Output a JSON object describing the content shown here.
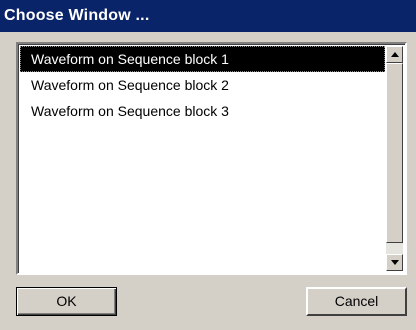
{
  "window": {
    "title": "Choose Window ..."
  },
  "list": {
    "items": [
      {
        "label": "Waveform on Sequence block 1",
        "selected": true
      },
      {
        "label": "Waveform on Sequence block 2",
        "selected": false
      },
      {
        "label": "Waveform on Sequence block 3",
        "selected": false
      }
    ]
  },
  "buttons": {
    "ok_label": "OK",
    "cancel_label": "Cancel"
  },
  "icons": {
    "scroll_up": "scroll-up-arrow-icon",
    "scroll_down": "scroll-down-arrow-icon"
  },
  "colors": {
    "titlebar": "#0a246a",
    "dialog": "#d4d0c8",
    "selection": "#000000"
  }
}
